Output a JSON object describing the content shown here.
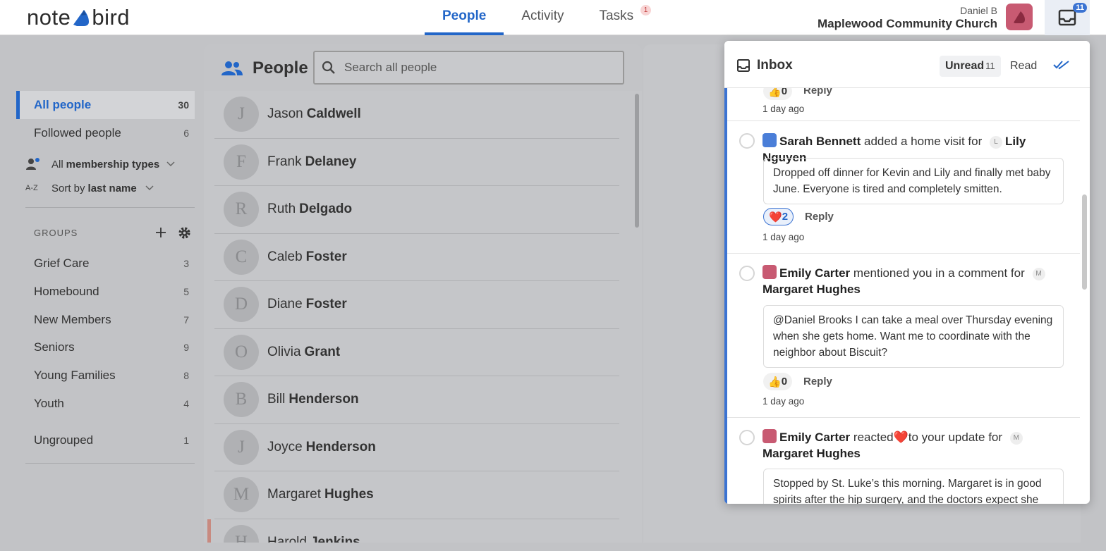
{
  "app": {
    "logo_left": "note",
    "logo_right": "bird"
  },
  "nav": {
    "tabs": [
      {
        "label": "People"
      },
      {
        "label": "Activity"
      },
      {
        "label": "Tasks",
        "badge": "1"
      }
    ]
  },
  "user": {
    "name": "Daniel B",
    "org": "Maplewood Community Church",
    "inbox_count": "11"
  },
  "sidebar": {
    "all_people": {
      "label": "All people",
      "count": "30"
    },
    "followed": {
      "label": "Followed people",
      "count": "6"
    },
    "membership_prefix": "All",
    "membership_bold": "membership types",
    "sort_prefix": "Sort by",
    "sort_bold": "last name",
    "sort_icon": "A-Z",
    "groups_title": "GROUPS",
    "groups": [
      {
        "label": "Grief Care",
        "count": "3"
      },
      {
        "label": "Homebound",
        "count": "5"
      },
      {
        "label": "New Members",
        "count": "7"
      },
      {
        "label": "Seniors",
        "count": "9"
      },
      {
        "label": "Young Families",
        "count": "8"
      },
      {
        "label": "Youth",
        "count": "4"
      }
    ],
    "ungrouped": {
      "label": "Ungrouped",
      "count": "1"
    }
  },
  "people_panel": {
    "title": "People",
    "search_placeholder": "Search all people",
    "people": [
      {
        "initial": "J",
        "first": "Jason",
        "last": "Caldwell"
      },
      {
        "initial": "F",
        "first": "Frank",
        "last": "Delaney"
      },
      {
        "initial": "R",
        "first": "Ruth",
        "last": "Delgado"
      },
      {
        "initial": "C",
        "first": "Caleb",
        "last": "Foster"
      },
      {
        "initial": "D",
        "first": "Diane",
        "last": "Foster"
      },
      {
        "initial": "O",
        "first": "Olivia",
        "last": "Grant"
      },
      {
        "initial": "B",
        "first": "Bill",
        "last": "Henderson"
      },
      {
        "initial": "J",
        "first": "Joyce",
        "last": "Henderson"
      },
      {
        "initial": "M",
        "first": "Margaret",
        "last": "Hughes"
      },
      {
        "initial": "H",
        "first": "Harold",
        "last": "Jenkins"
      }
    ]
  },
  "inbox": {
    "title": "Inbox",
    "unread_label": "Unread",
    "unread_count": "11",
    "read_label": "Read",
    "partial": {
      "reaction": "0",
      "reply": "Reply",
      "time": "1 day ago"
    },
    "items": [
      {
        "actor": "Sarah Bennett",
        "action": "added a home visit for",
        "subject_initial": "L",
        "subject": "Lily Nguyen",
        "body": "Dropped off dinner for Kevin and Lily and finally met baby June. Everyone is tired and completely smitten.",
        "reaction": "2",
        "reply": "Reply",
        "time": "1 day ago"
      },
      {
        "actor": "Emily Carter",
        "action": "mentioned you in a comment for",
        "subject_initial": "M",
        "subject": "Margaret Hughes",
        "body": "@Daniel Brooks I can take a meal over Thursday evening when she gets home. Want me to coordinate with the neighbor about Biscuit?",
        "reaction": "0",
        "reply": "Reply",
        "time": "1 day ago"
      },
      {
        "actor": "Emily Carter",
        "action_pre": "reacted",
        "action_post": "to your update for",
        "subject_initial": "M",
        "subject": "Margaret Hughes",
        "body": "Stopped by St. Luke’s this morning. Margaret is in good spirits after the hip surgery, and the doctors expect she can"
      }
    ]
  },
  "colors": {
    "accent": "#2266c8",
    "badge_red": "#c03a3a",
    "avatar_pink": "#c85a72",
    "avatar_blue": "#4a7ed8",
    "overlay_gray": "#c2c3c6"
  },
  "icons": [
    "people-icon",
    "search-icon",
    "inbox-icon",
    "check-all-icon",
    "plus-icon",
    "gear-icon",
    "chevron-down-icon",
    "heart-icon",
    "thumbs-up-icon",
    "bird-icon"
  ]
}
